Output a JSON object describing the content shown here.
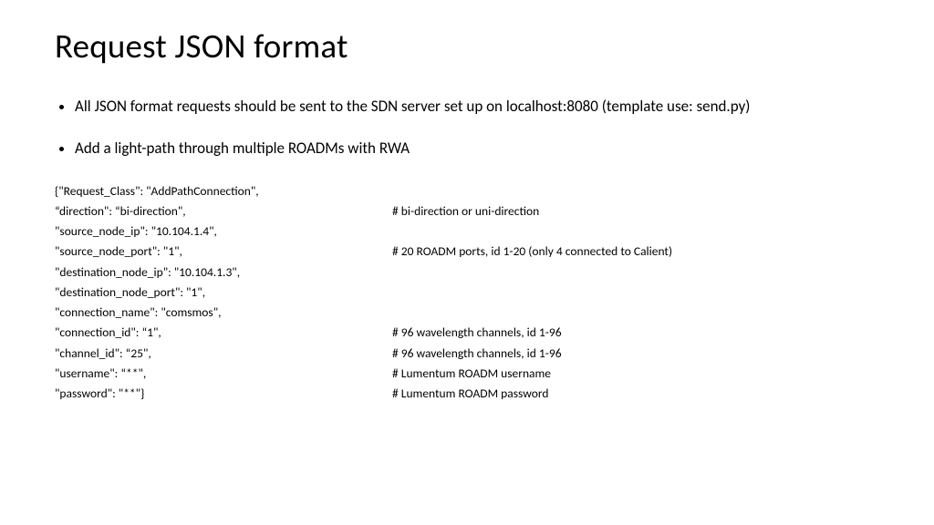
{
  "title": "Request JSON format",
  "bullets": [
    "All JSON format requests should be sent to the SDN server set up on localhost:8080 (template use: send.py)",
    "Add a light-path through multiple ROADMs with RWA"
  ],
  "code": [
    {
      "left": "{\"Request_Class\": \"AddPathConnection\",",
      "right": ""
    },
    {
      "left": "“direction\": “bi-direction\",",
      "right": "# bi-direction or uni-direction"
    },
    {
      "left": "\"source_node_ip\": \"10.104.1.4\",",
      "right": ""
    },
    {
      "left": "\"source_node_port\": \"1\",",
      "right": "# 20 ROADM ports, id 1-20 (only 4 connected to Calient)"
    },
    {
      "left": "\"destination_node_ip\": \"10.104.1.3\",",
      "right": ""
    },
    {
      "left": "\"destination_node_port\": \"1\",",
      "right": ""
    },
    {
      "left": "\"connection_name\": \"comsmos\",",
      "right": ""
    },
    {
      "left": "\"connection_id\": “1\",",
      "right": "# 96 wavelength channels, id 1-96"
    },
    {
      "left": "\"channel_id\": “25\",",
      "right": "# 96 wavelength channels, id 1-96"
    },
    {
      "left": "\"username\": “**\",",
      "right": "# Lumentum ROADM username"
    },
    {
      "left": "\"password\": \"**\"}",
      "right": "# Lumentum ROADM password"
    }
  ]
}
